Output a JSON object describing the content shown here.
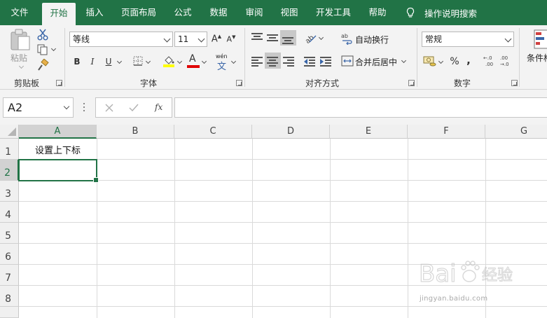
{
  "menu": {
    "tabs": [
      "文件",
      "开始",
      "插入",
      "页面布局",
      "公式",
      "数据",
      "审阅",
      "视图",
      "开发工具",
      "帮助"
    ],
    "active_tab": "开始",
    "tell_me": "操作说明搜索"
  },
  "ribbon": {
    "clipboard": {
      "label": "剪贴板",
      "paste": "粘贴"
    },
    "font": {
      "label": "字体",
      "font_name": "等线",
      "font_size": "11",
      "bold": "B",
      "italic": "I",
      "underline": "U",
      "phonetic": "wén"
    },
    "alignment": {
      "label": "对齐方式",
      "wrap_text": "自动换行",
      "merge_center": "合并后居中"
    },
    "number": {
      "label": "数字",
      "format": "常规",
      "percent": "%",
      "comma": ","
    },
    "styles": {
      "conditional_format": "条件格"
    }
  },
  "formula_bar": {
    "name_box": "A2",
    "fx": "fx",
    "value": ""
  },
  "sheet": {
    "columns": [
      "A",
      "B",
      "C",
      "D",
      "E",
      "F",
      "G"
    ],
    "rows": [
      "1",
      "2",
      "3",
      "4",
      "5",
      "6",
      "7",
      "8"
    ],
    "selected_cell": "A2",
    "cells": {
      "A1": "设置上下标"
    }
  },
  "watermark": {
    "brand": "Bai",
    "product": "经验",
    "url": "jingyan.baidu.com"
  },
  "colors": {
    "accent": "#217346",
    "ribbon_bg": "#f3f3f3"
  }
}
